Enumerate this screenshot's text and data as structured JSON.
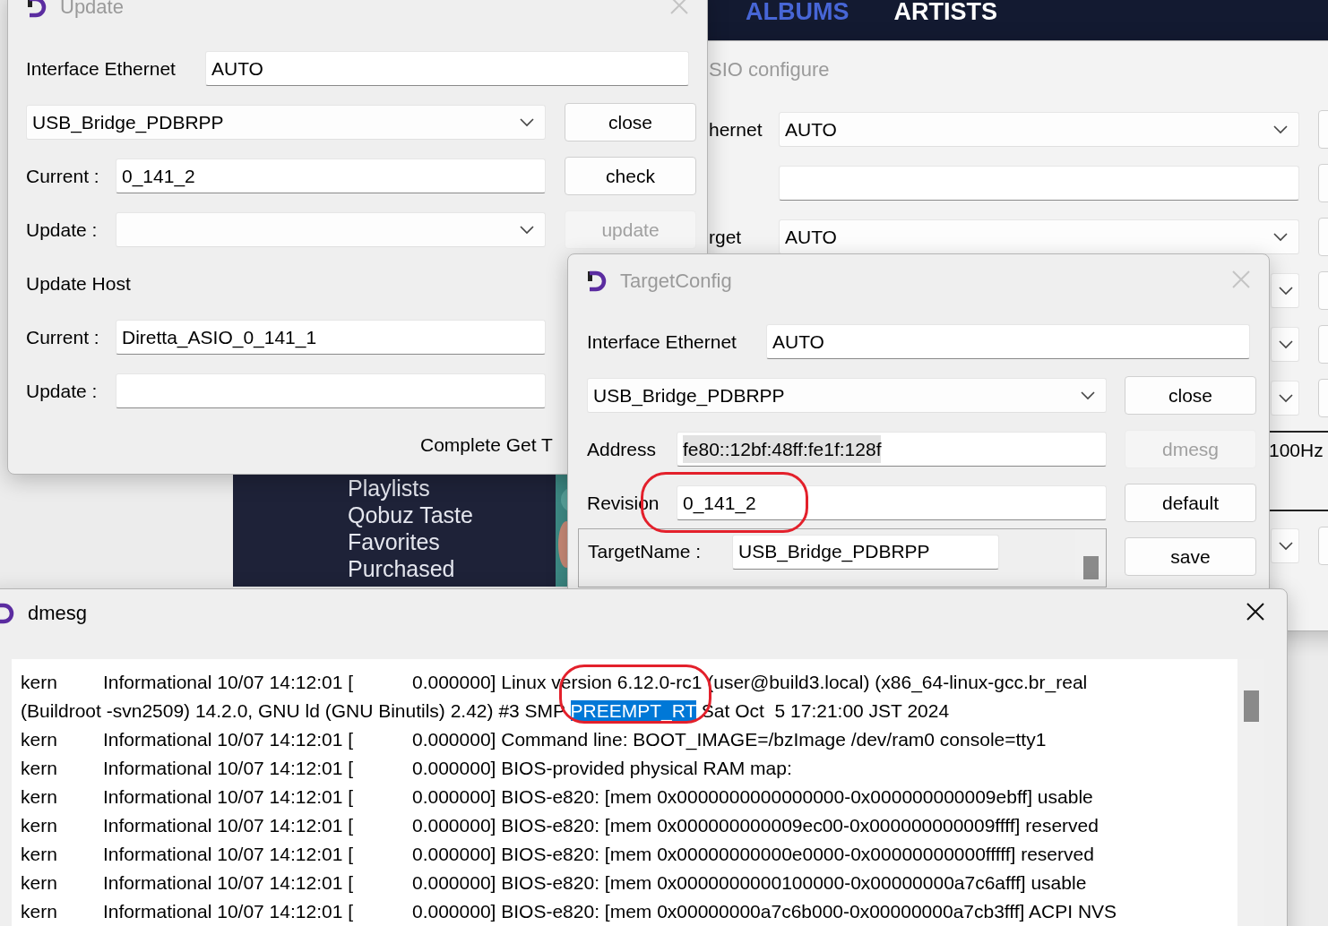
{
  "music_app": {
    "nav": [
      {
        "label": "ALBUMS",
        "selected": true
      },
      {
        "label": "ARTISTS",
        "selected": false
      }
    ],
    "sidebar": {
      "items": [
        "Playlists",
        "Qobuz Taste",
        "Favorites",
        "Purchased"
      ]
    }
  },
  "asio_window": {
    "title": "SIO configure",
    "active": false,
    "rows": [
      {
        "kind": "select",
        "label": "hernet",
        "value": "AUTO"
      },
      {
        "kind": "input"
      },
      {
        "kind": "select",
        "label": "rget",
        "value": "AUTO"
      },
      {
        "kind": "select"
      },
      {
        "kind": "select"
      },
      {
        "kind": "select"
      },
      {
        "kind": "group",
        "value": "100Hz"
      },
      {
        "kind": "select"
      }
    ]
  },
  "update_window": {
    "title": "Update",
    "active": false,
    "interface": {
      "label": "Interface Ethernet",
      "value": "AUTO"
    },
    "device": {
      "value": "USB_Bridge_PDBRPP"
    },
    "current_label": "Current :",
    "current": "0_141_2",
    "update_label": "Update :",
    "host": {
      "heading": "Update Host",
      "current_label": "Current :",
      "current": "Diretta_ASIO_0_141_1",
      "update_label": "Update :"
    },
    "status": "Complete Get T",
    "buttons": [
      {
        "label": "close",
        "disabled": false
      },
      {
        "label": "check",
        "disabled": false
      },
      {
        "label": "update",
        "disabled": true
      }
    ]
  },
  "target_config": {
    "title": "TargetConfig",
    "active": false,
    "interface": {
      "label": "Interface Ethernet",
      "value": "AUTO"
    },
    "device": {
      "value": "USB_Bridge_PDBRPP"
    },
    "address_label": "Address",
    "address": "fe80::12bf:48ff:fe1f:128f",
    "address_selected": true,
    "revision_label": "Revision",
    "revision": "0_141_2",
    "target_name_label": "TargetName :",
    "target_name": "USB_Bridge_PDBRPP",
    "buttons": [
      {
        "label": "close",
        "disabled": false
      },
      {
        "label": "dmesg",
        "disabled": true
      },
      {
        "label": "default",
        "disabled": false
      },
      {
        "label": "save",
        "disabled": false
      }
    ]
  },
  "dmesg": {
    "title": "dmesg",
    "active": true,
    "entries": [
      {
        "facility": "kern",
        "level": "Informational 10/07 14:12:01 [",
        "message": [
          {
            "text": "0.000000] Linux version 6.12.0-rc1 (user@build3.local) (x86_64-linux-gcc.br_real (Buildroot -svn2509) 14.2.0, GNU ld (GNU Binutils) 2.42) #3 SMP ",
            "selected": false
          },
          {
            "text": "PREEMPT_RT",
            "selected": true
          },
          {
            "text": " Sat Oct  5 17:21:00 JST 2024",
            "selected": false
          }
        ]
      },
      {
        "facility": "kern",
        "level": "Informational 10/07 14:12:01 [",
        "message": [
          {
            "text": "0.000000] Command line: BOOT_IMAGE=/bzImage /dev/ram0 console=tty1",
            "selected": false
          }
        ]
      },
      {
        "facility": "kern",
        "level": "Informational 10/07 14:12:01 [",
        "message": [
          {
            "text": "0.000000] BIOS-provided physical RAM map:",
            "selected": false
          }
        ]
      },
      {
        "facility": "kern",
        "level": "Informational 10/07 14:12:01 [",
        "message": [
          {
            "text": "0.000000] BIOS-e820: [mem 0x0000000000000000-0x000000000009ebff] usable",
            "selected": false
          }
        ]
      },
      {
        "facility": "kern",
        "level": "Informational 10/07 14:12:01 [",
        "message": [
          {
            "text": "0.000000] BIOS-e820: [mem 0x000000000009ec00-0x000000000009ffff] reserved",
            "selected": false
          }
        ]
      },
      {
        "facility": "kern",
        "level": "Informational 10/07 14:12:01 [",
        "message": [
          {
            "text": "0.000000] BIOS-e820: [mem 0x00000000000e0000-0x00000000000fffff] reserved",
            "selected": false
          }
        ]
      },
      {
        "facility": "kern",
        "level": "Informational 10/07 14:12:01 [",
        "message": [
          {
            "text": "0.000000] BIOS-e820: [mem 0x0000000000100000-0x00000000a7c6afff] usable",
            "selected": false
          }
        ]
      },
      {
        "facility": "kern",
        "level": "Informational 10/07 14:12:01 [",
        "message": [
          {
            "text": "0.000000] BIOS-e820: [mem 0x00000000a7c6b000-0x00000000a7cb3fff] ACPI NVS",
            "selected": false
          }
        ]
      }
    ]
  },
  "annotations": [
    {
      "kind": "ellipse"
    },
    {
      "kind": "ellipse"
    }
  ]
}
